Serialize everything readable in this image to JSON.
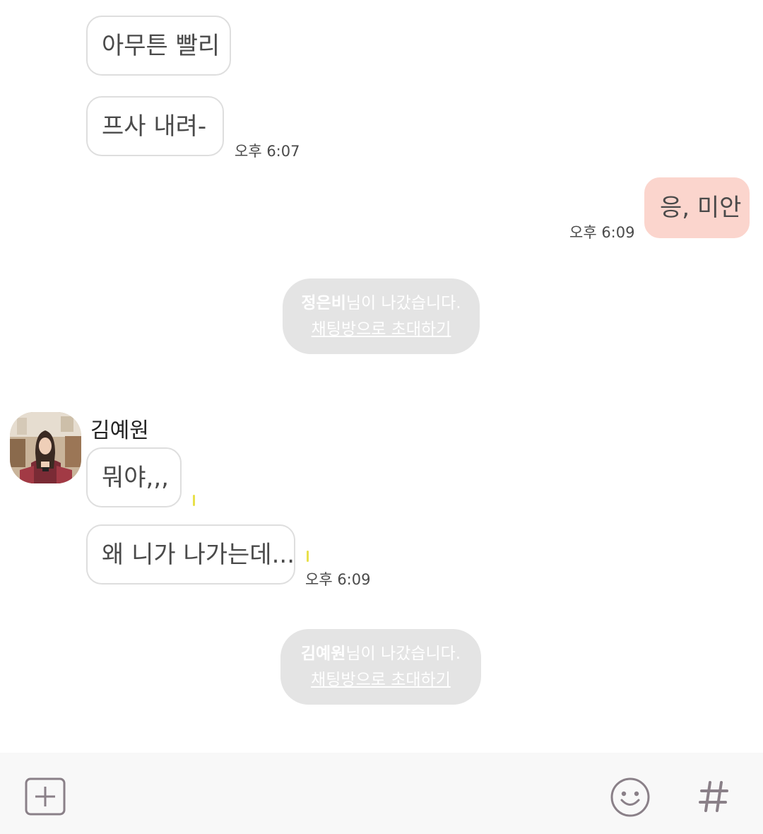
{
  "messages": {
    "m1": "아무튼 빨리",
    "m2": "프사 내려-",
    "m2_time": "오후 6:07",
    "m3": "응, 미안",
    "m3_time": "오후 6:09",
    "m4": "뭐야,,,",
    "m4_unread": "1",
    "m5": "왜 니가 나가는데...",
    "m5_unread": "1",
    "m5_time": "오후 6:09"
  },
  "system_messages": [
    {
      "name": "정은비",
      "suffix": "님이 나갔습니다.",
      "invite": "채팅방으로 초대하기"
    },
    {
      "name": "김예원",
      "suffix": "님이 나갔습니다.",
      "invite": "채팅방으로 초대하기"
    }
  ],
  "sender": {
    "name": "김예원"
  },
  "input_bar": {
    "icons": [
      "add-icon",
      "emoji-icon",
      "hashtag-icon"
    ]
  },
  "colors": {
    "my_bubble": "#fbd5cd",
    "system_bubble": "#e4e4e4",
    "input_bar_bg": "#f8f8f8"
  }
}
